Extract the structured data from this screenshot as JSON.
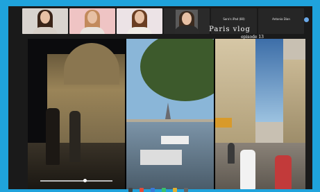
{
  "participants": [
    {
      "name": "",
      "hair": "#3a2418",
      "torso": "#d8d0c8",
      "bg": "#d9d4cf"
    },
    {
      "name": "",
      "hair": "#c28a5c",
      "torso": "#e9e3dd",
      "bg": "#efc4c4"
    },
    {
      "name": "",
      "hair": "#6a3e22",
      "torso": "#f0ece6",
      "bg": "#ece3e6"
    },
    {
      "name": "",
      "hair": "#3b2a1e",
      "torso": "#2b2b2b",
      "bg": "#5a5a5a"
    }
  ],
  "phone_tiles": [
    {
      "name": "Sara's iPad (80)",
      "sub": ""
    },
    {
      "name": "Antonia Dian",
      "sub": ""
    }
  ],
  "share": {
    "right_caption": "Paris vlog",
    "right_caption_sub": "episode 13"
  },
  "colors": {
    "frame": "#1fa3dc",
    "window": "#1a1a1a"
  }
}
